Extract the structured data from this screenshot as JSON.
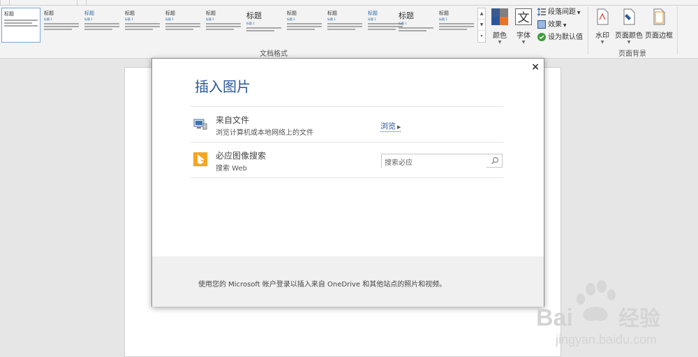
{
  "ribbon": {
    "gallery": {
      "group_label": "文档格式",
      "thumbnails": [
        {
          "title": "标题"
        },
        {
          "title": "标题",
          "subtitle": "标题 1"
        },
        {
          "title": "标题",
          "subtitle": "标题 1"
        },
        {
          "title": "标题",
          "subtitle": "标题 1"
        },
        {
          "title": "标题",
          "subtitle": "标题 1"
        },
        {
          "title": "标题",
          "subtitle": "标题 1"
        },
        {
          "title": "标题",
          "subtitle": "标题 1"
        },
        {
          "title": "标题",
          "subtitle": "标题 1"
        },
        {
          "title": "标题",
          "subtitle": "标题 1"
        },
        {
          "title": "标题",
          "subtitle": "标题 1"
        },
        {
          "title": "标题",
          "subtitle": "标题 1"
        },
        {
          "title": "标题",
          "subtitle": "标题 1"
        }
      ]
    },
    "colors_label": "颜色",
    "fonts_label": "字体",
    "paragraph_spacing_label": "段落间距",
    "effects_label": "效果",
    "set_default_label": "设为默认值",
    "watermark_label": "水印",
    "page_color_label": "页面颜色",
    "page_borders_label": "页面边框",
    "page_background_group": "页面背景",
    "accent_colors": {
      "blue": "#2b579a",
      "orange": "#e8742a",
      "navy": "#3b5a8c"
    }
  },
  "dialog": {
    "title": "插入图片",
    "close_glyph": "×",
    "from_file": {
      "title": "来自文件",
      "subtitle": "浏览计算机或本地网络上的文件",
      "browse_label": "浏览"
    },
    "bing": {
      "title": "必应图像搜索",
      "subtitle": "搜索 Web",
      "placeholder": "搜索必应"
    },
    "footer_text": "使用您的 Microsoft 帐户登录以插入来自 OneDrive 和其他站点的照片和视频。"
  },
  "watermark": {
    "brand": "Bai",
    "brand_tail": "经验",
    "url": "jingyan.baidu.com"
  }
}
